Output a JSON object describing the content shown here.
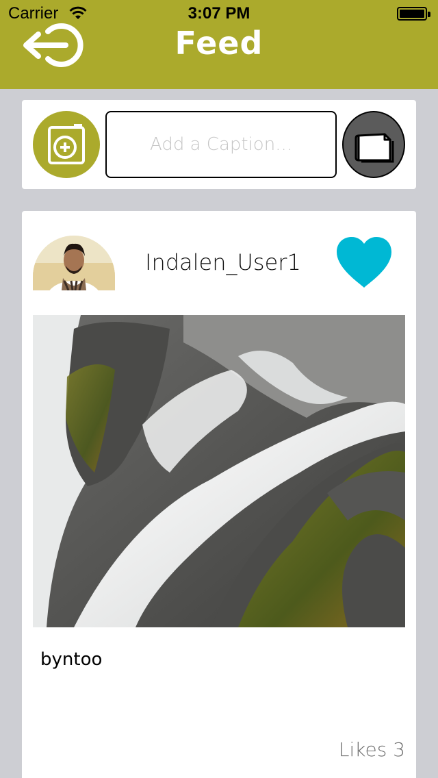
{
  "status_bar": {
    "carrier": "Carrier",
    "time": "3:07 PM",
    "wifi_icon": "wifi-icon",
    "battery_icon": "battery-icon"
  },
  "nav_bar": {
    "title": "Feed",
    "back_icon": "logout-arrow-icon",
    "background_color": "#abaa2c"
  },
  "composer": {
    "camera_icon": "camera-add-icon",
    "caption_placeholder": "Add a Caption...",
    "caption_value": "",
    "post_icon": "note-paper-icon"
  },
  "feed": {
    "posts": [
      {
        "username": "Indalen_User1",
        "avatar_icon": "user-avatar",
        "like_icon": "heart-icon",
        "like_color": "#00b8d4",
        "photo": "waterfall-photo",
        "caption": "byntoo",
        "likes_label": "Likes 3"
      }
    ]
  }
}
